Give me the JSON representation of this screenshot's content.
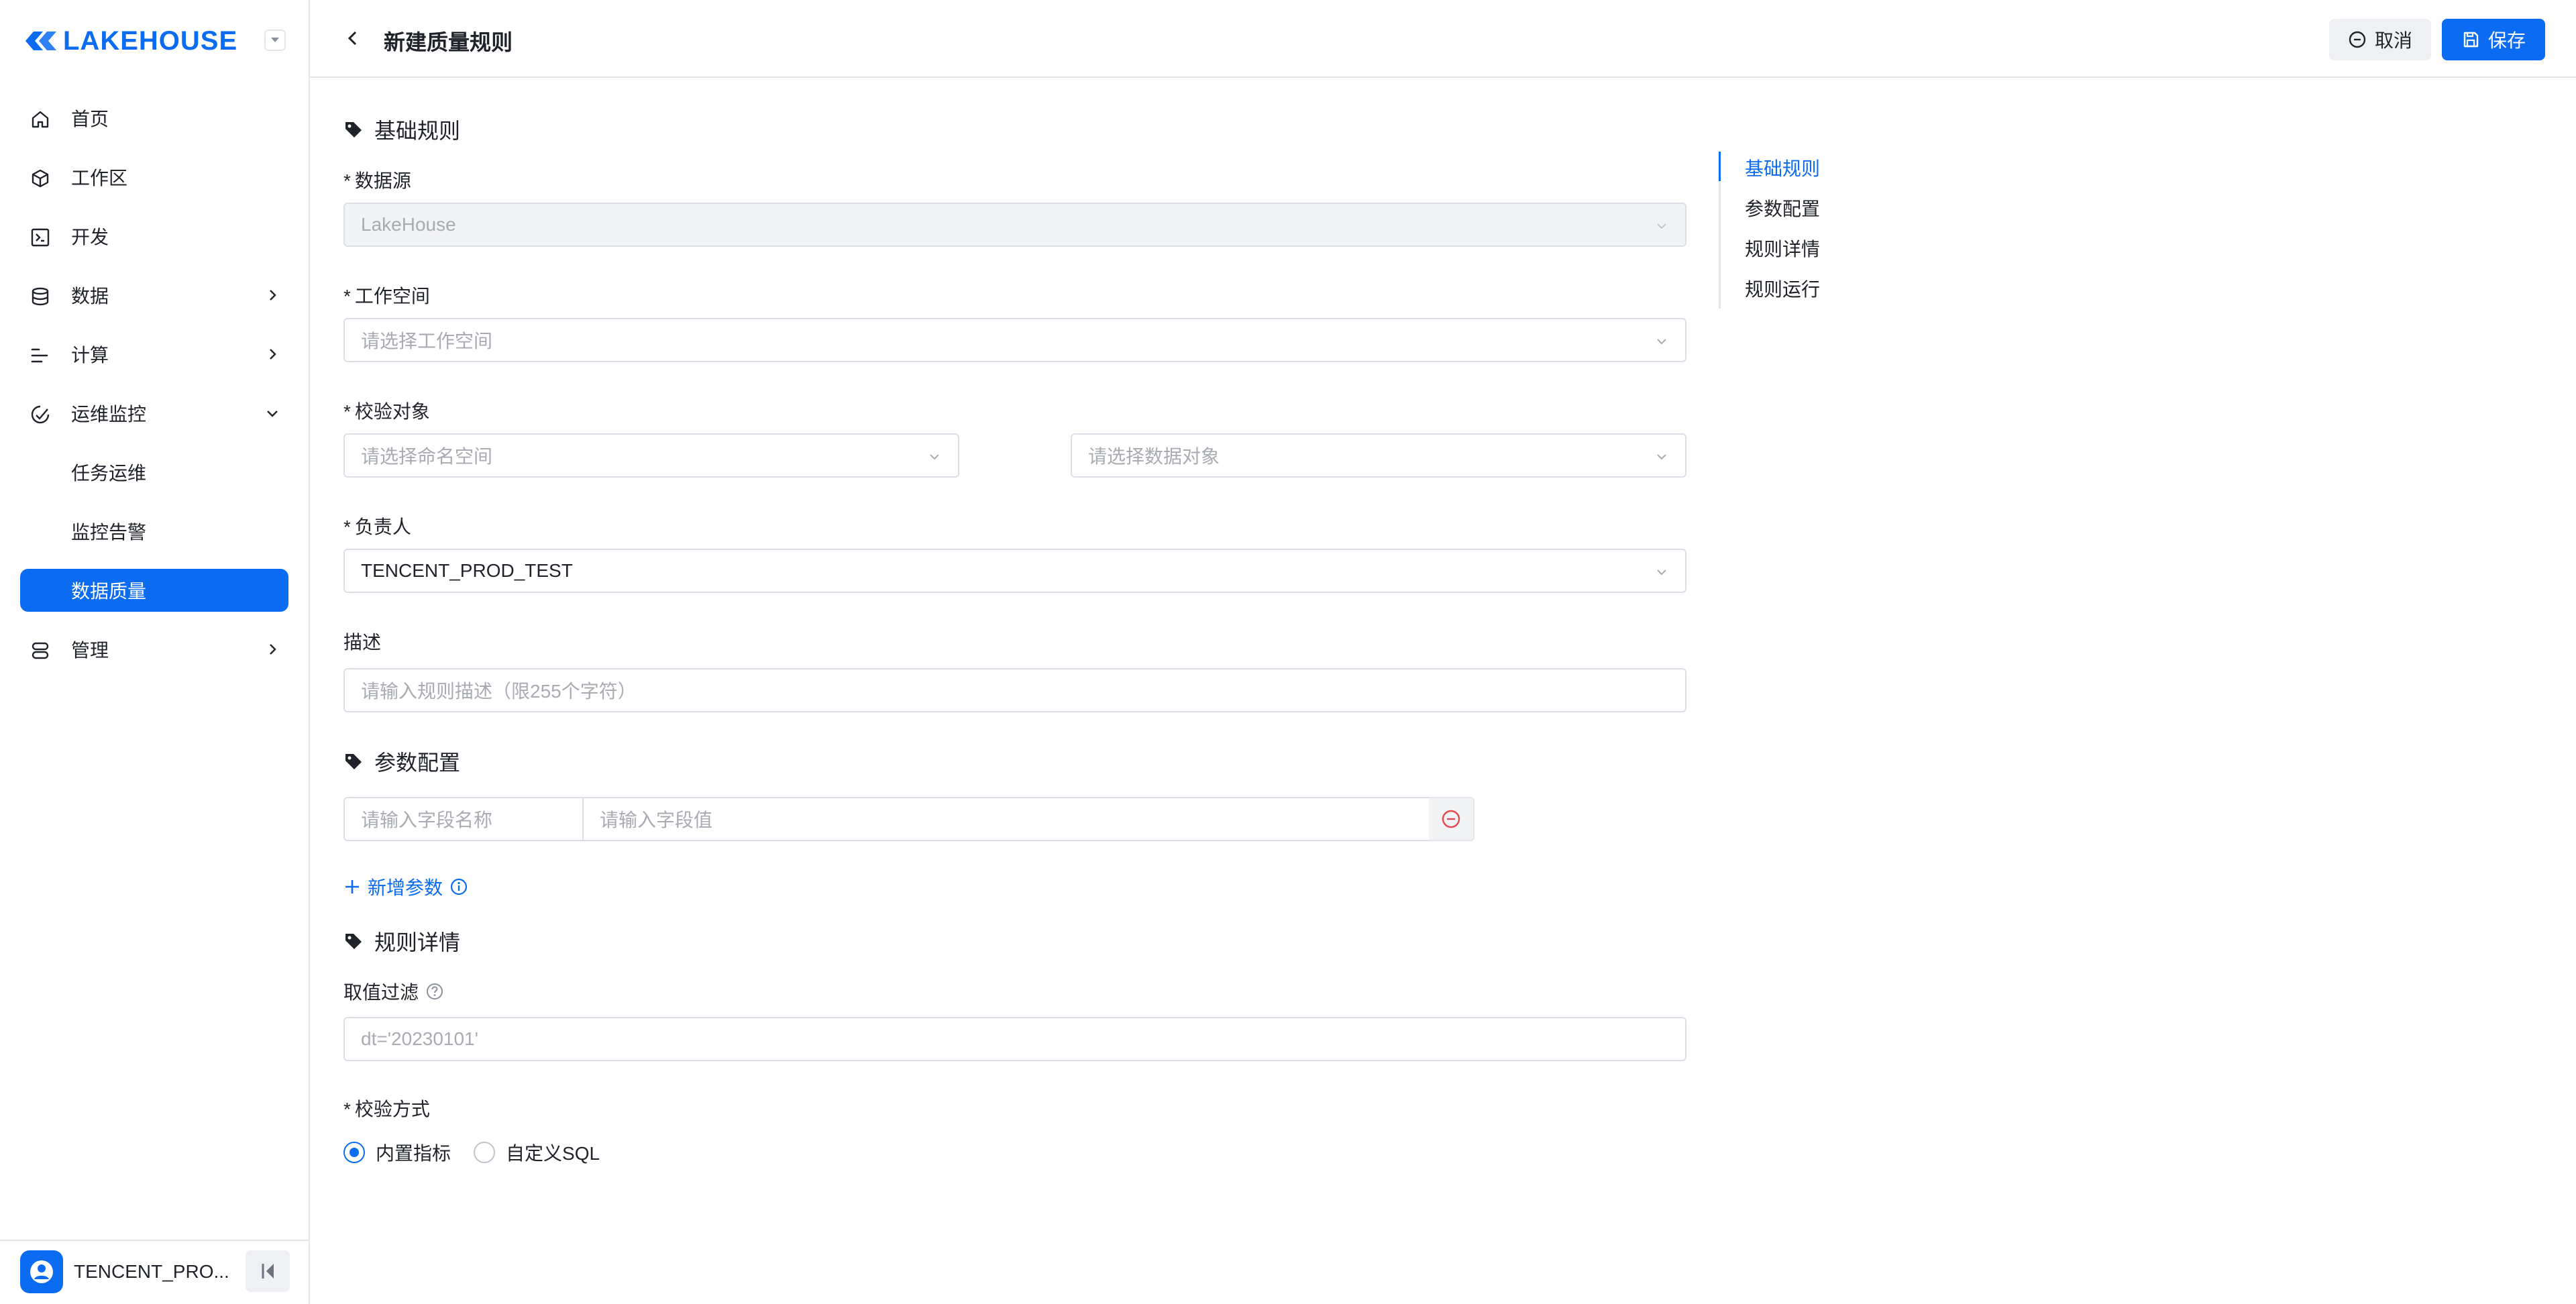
{
  "brand": {
    "name": "LAKEHOUSE",
    "accent": "#0b6cf2"
  },
  "sidebar": {
    "items": [
      {
        "label": "首页",
        "icon": "home-icon"
      },
      {
        "label": "工作区",
        "icon": "cube-icon"
      },
      {
        "label": "开发",
        "icon": "terminal-icon"
      },
      {
        "label": "数据",
        "icon": "database-icon"
      },
      {
        "label": "计算",
        "icon": "compute-icon"
      },
      {
        "label": "运维监控",
        "icon": "monitor-icon"
      },
      {
        "label": "任务运维"
      },
      {
        "label": "监控告警"
      },
      {
        "label": "数据质量"
      },
      {
        "label": "管理",
        "icon": "server-icon"
      }
    ],
    "user": {
      "name": "TENCENT_PRO..."
    }
  },
  "header": {
    "title": "新建质量规则",
    "cancel_label": "取消",
    "save_label": "保存"
  },
  "form": {
    "sections": {
      "basic": "基础规则",
      "params": "参数配置",
      "details": "规则详情"
    },
    "datasource": {
      "label": "数据源",
      "value": "LakeHouse"
    },
    "workspace": {
      "label": "工作空间",
      "placeholder": "请选择工作空间"
    },
    "target": {
      "label": "校验对象",
      "namespace_placeholder": "请选择命名空间",
      "object_placeholder": "请选择数据对象"
    },
    "owner": {
      "label": "负责人",
      "value": "TENCENT_PROD_TEST"
    },
    "description": {
      "label": "描述",
      "placeholder": "请输入规则描述（限255个字符）"
    },
    "param_row": {
      "name_placeholder": "请输入字段名称",
      "value_placeholder": "请输入字段值"
    },
    "add_param_label": "新增参数",
    "filter": {
      "label": "取值过滤",
      "placeholder": "dt='20230101'"
    },
    "check_method": {
      "label": "校验方式",
      "options": [
        "内置指标",
        "自定义SQL"
      ],
      "selected": "内置指标"
    }
  },
  "anchor": {
    "items": [
      "基础规则",
      "参数配置",
      "规则详情",
      "规则运行"
    ],
    "active": "基础规则"
  }
}
